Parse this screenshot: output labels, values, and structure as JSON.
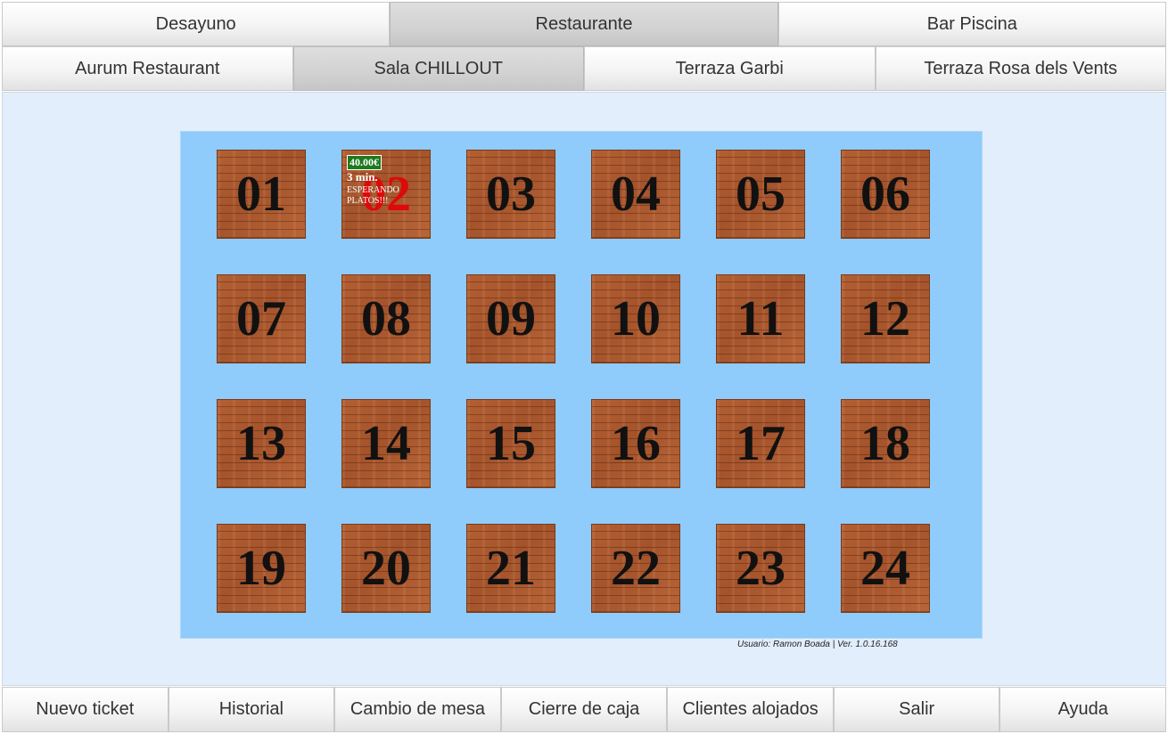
{
  "top_tabs": [
    {
      "label": "Desayuno",
      "active": false
    },
    {
      "label": "Restaurante",
      "active": true
    },
    {
      "label": "Bar Piscina",
      "active": false
    }
  ],
  "sub_tabs": [
    {
      "label": "Aurum Restaurant",
      "active": false
    },
    {
      "label": "Sala CHILLOUT",
      "active": true
    },
    {
      "label": "Terraza Garbi",
      "active": false
    },
    {
      "label": "Terraza Rosa dels Vents",
      "active": false
    }
  ],
  "tables": [
    {
      "number": "01"
    },
    {
      "number": "02",
      "busy": true,
      "amount": "40.00€",
      "time": "3 min.",
      "status": "ESPERANDO PLATOS!!!"
    },
    {
      "number": "03"
    },
    {
      "number": "04"
    },
    {
      "number": "05"
    },
    {
      "number": "06"
    },
    {
      "number": "07"
    },
    {
      "number": "08"
    },
    {
      "number": "09"
    },
    {
      "number": "10"
    },
    {
      "number": "11"
    },
    {
      "number": "12"
    },
    {
      "number": "13"
    },
    {
      "number": "14"
    },
    {
      "number": "15"
    },
    {
      "number": "16"
    },
    {
      "number": "17"
    },
    {
      "number": "18"
    },
    {
      "number": "19"
    },
    {
      "number": "20"
    },
    {
      "number": "21"
    },
    {
      "number": "22"
    },
    {
      "number": "23"
    },
    {
      "number": "24"
    }
  ],
  "status_line": "Usuario: Ramon Boada | Ver. 1.0.16.168",
  "footer_buttons": [
    "Nuevo ticket",
    "Historial",
    "Cambio de mesa",
    "Cierre de caja",
    "Clientes alojados",
    "Salir",
    "Ayuda"
  ],
  "colors": {
    "floor": "#8fcbfb",
    "background": "#e2eefc",
    "busy_number": "#dd0a0a",
    "amount_badge": "#1e7a1e"
  }
}
